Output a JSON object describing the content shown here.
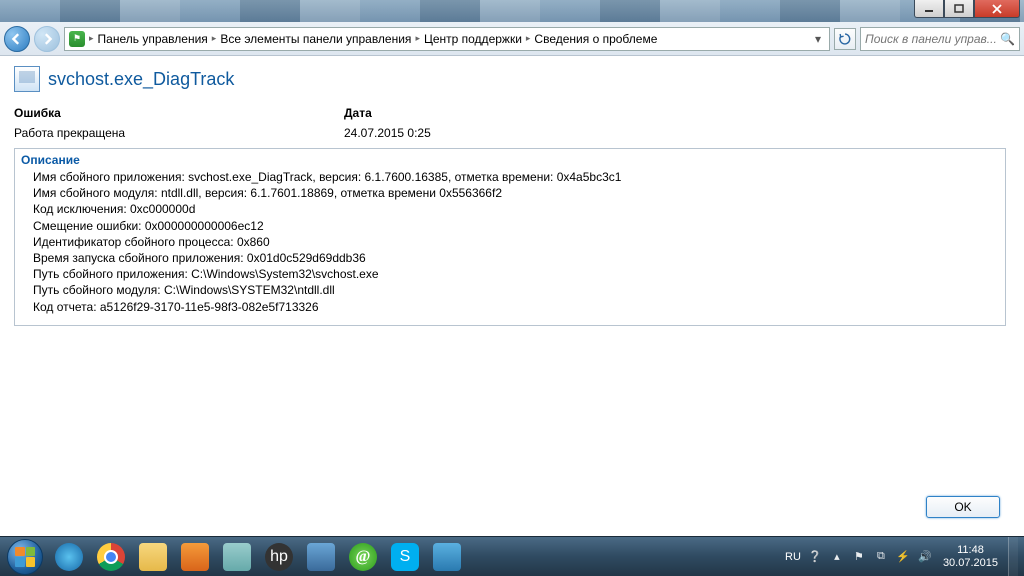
{
  "window": {
    "minimize": "–",
    "maximize": "□",
    "close": "✕"
  },
  "breadcrumb": {
    "items": [
      "Панель управления",
      "Все элементы панели управления",
      "Центр поддержки",
      "Сведения о проблеме"
    ]
  },
  "search": {
    "placeholder": "Поиск в панели управ..."
  },
  "page": {
    "title": "svchost.exe_DiagTrack"
  },
  "columns": {
    "error_label": "Ошибка",
    "error_value": "Работа прекращена",
    "date_label": "Дата",
    "date_value": "24.07.2015 0:25"
  },
  "description": {
    "heading": "Описание",
    "lines": [
      "Имя сбойного приложения: svchost.exe_DiagTrack, версия: 6.1.7600.16385, отметка времени: 0x4a5bc3c1",
      "Имя сбойного модуля: ntdll.dll, версия: 6.1.7601.18869, отметка времени 0x556366f2",
      "Код исключения: 0xc000000d",
      "Смещение ошибки: 0x000000000006ec12",
      "Идентификатор сбойного процесса: 0x860",
      "Время запуска сбойного приложения: 0x01d0c529d69ddb36",
      "Путь сбойного приложения: C:\\Windows\\System32\\svchost.exe",
      "Путь сбойного модуля: C:\\Windows\\SYSTEM32\\ntdll.dll",
      "Код отчета: a5126f29-3170-11e5-98f3-082e5f713326"
    ]
  },
  "buttons": {
    "ok": "OK"
  },
  "tray": {
    "lang": "RU",
    "time": "11:48",
    "date": "30.07.2015"
  }
}
